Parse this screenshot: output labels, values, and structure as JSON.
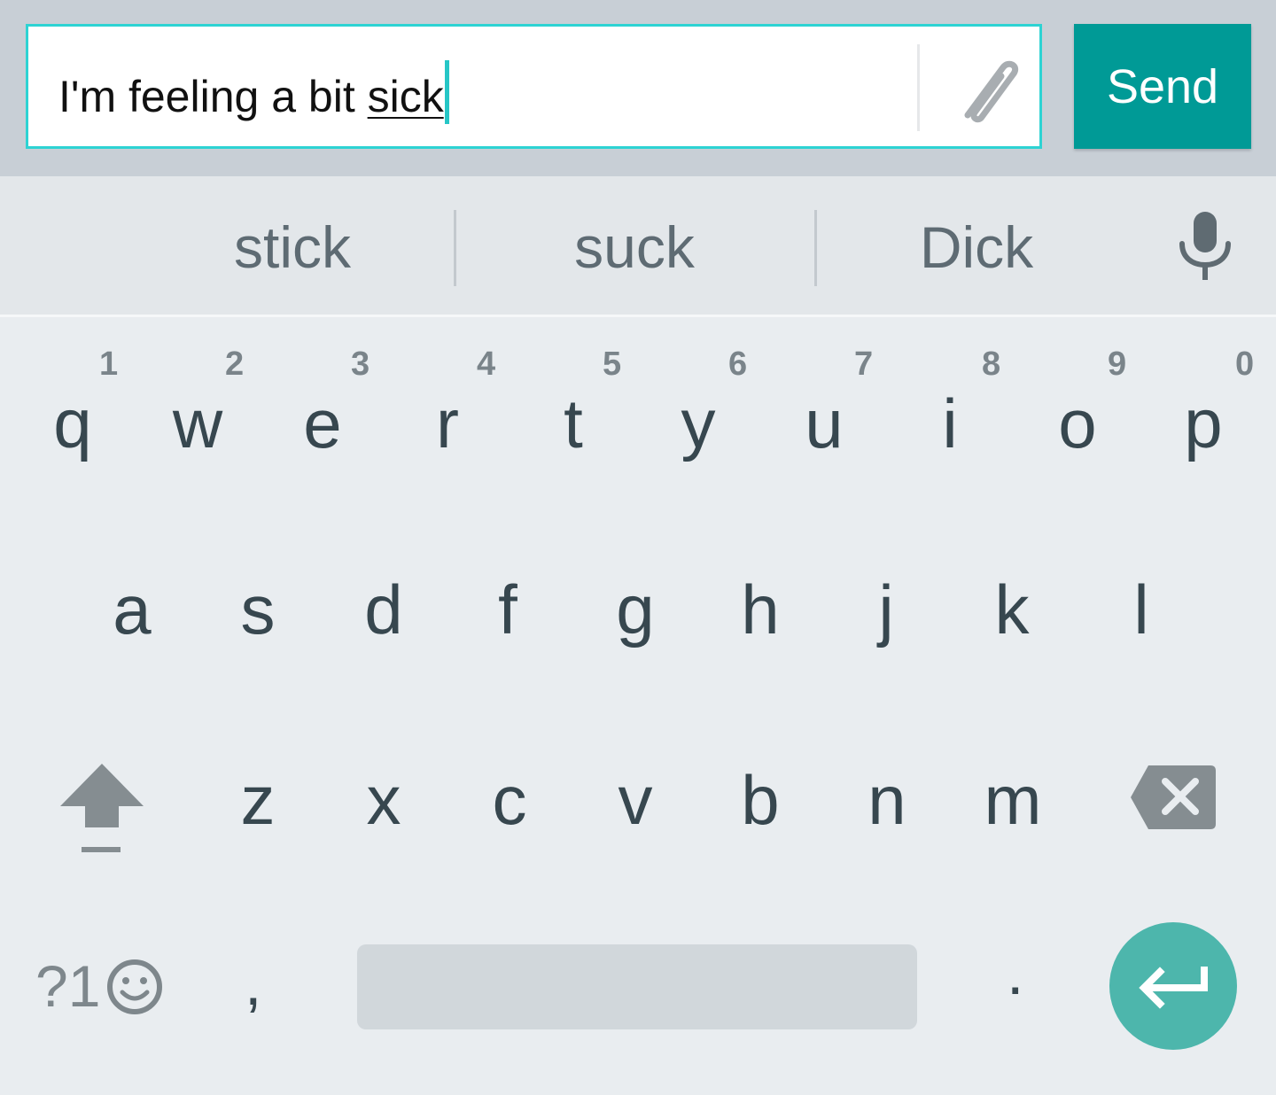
{
  "compose": {
    "text_before": "I'm feeling a bit ",
    "composing_word": "sick",
    "attach_icon": "paperclip-icon",
    "send_label": "Send"
  },
  "suggestions": {
    "items": [
      "stick",
      "suck",
      "Dick"
    ],
    "mic_icon": "microphone-icon"
  },
  "keyboard": {
    "row1": [
      {
        "letter": "q",
        "hint": "1"
      },
      {
        "letter": "w",
        "hint": "2"
      },
      {
        "letter": "e",
        "hint": "3"
      },
      {
        "letter": "r",
        "hint": "4"
      },
      {
        "letter": "t",
        "hint": "5"
      },
      {
        "letter": "y",
        "hint": "6"
      },
      {
        "letter": "u",
        "hint": "7"
      },
      {
        "letter": "i",
        "hint": "8"
      },
      {
        "letter": "o",
        "hint": "9"
      },
      {
        "letter": "p",
        "hint": "0"
      }
    ],
    "row2": [
      "a",
      "s",
      "d",
      "f",
      "g",
      "h",
      "j",
      "k",
      "l"
    ],
    "row3": [
      "z",
      "x",
      "c",
      "v",
      "b",
      "n",
      "m"
    ],
    "shift_icon": "shift-arrow-icon",
    "backspace_icon": "backspace-icon",
    "symbols_label": "?1",
    "emoji_icon": "smiley-icon",
    "comma": ",",
    "period": ".",
    "enter_icon": "enter-arrow-icon"
  },
  "colors": {
    "accent_teal": "#009a96",
    "field_border": "#2ed3d3",
    "enter_button": "#4db6ac",
    "key_text": "#37474f"
  }
}
